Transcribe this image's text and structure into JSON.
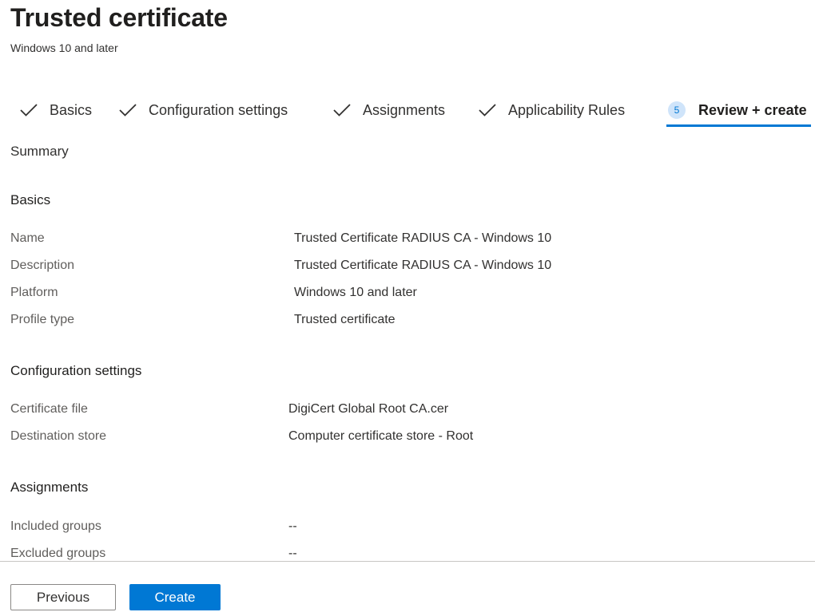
{
  "header": {
    "title": "Trusted certificate",
    "subtitle": "Windows 10 and later"
  },
  "wizard": {
    "steps": [
      {
        "label": "Basics",
        "state": "completed"
      },
      {
        "label": "Configuration settings",
        "state": "completed"
      },
      {
        "label": "Assignments",
        "state": "completed"
      },
      {
        "label": "Applicability Rules",
        "state": "completed"
      },
      {
        "label": "Review + create",
        "state": "active",
        "number": "5"
      }
    ]
  },
  "summary": {
    "label": "Summary",
    "basics": {
      "heading": "Basics",
      "rows": [
        {
          "label": "Name",
          "value": "Trusted Certificate RADIUS CA - Windows 10"
        },
        {
          "label": "Description",
          "value": "Trusted Certificate RADIUS CA - Windows 10"
        },
        {
          "label": "Platform",
          "value": "Windows 10 and later"
        },
        {
          "label": "Profile type",
          "value": "Trusted certificate"
        }
      ]
    },
    "configuration": {
      "heading": "Configuration settings",
      "rows": [
        {
          "label": "Certificate file",
          "value": "DigiCert Global Root CA.cer"
        },
        {
          "label": "Destination store",
          "value": "Computer certificate store - Root"
        }
      ]
    },
    "assignments": {
      "heading": "Assignments",
      "rows": [
        {
          "label": "Included groups",
          "value": "--"
        },
        {
          "label": "Excluded groups",
          "value": "--"
        }
      ]
    }
  },
  "footer": {
    "previous_label": "Previous",
    "create_label": "Create"
  },
  "colors": {
    "accent": "#0078d4",
    "step_badge_bg": "#cfe4fa",
    "label_text": "#605e5c"
  },
  "icons": {
    "completed_step": "checkmark-icon"
  }
}
